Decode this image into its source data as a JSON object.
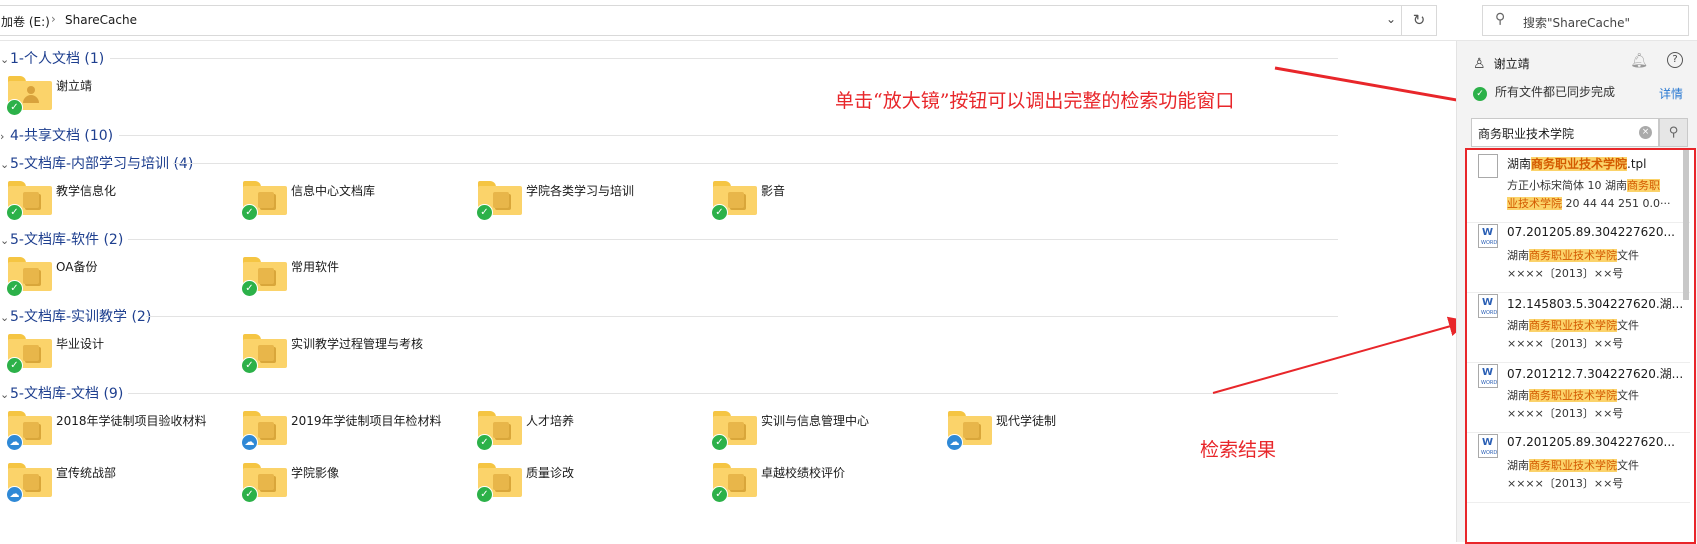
{
  "address": {
    "drive": "加卷 (E:)",
    "folder": "ShareCache",
    "search_placeholder": "搜索\"ShareCache\""
  },
  "groups": [
    {
      "title": "1-个人文档 (1)",
      "items": [
        {
          "name": "谢立靖",
          "status": "ok",
          "kind": "user"
        }
      ]
    },
    {
      "title": "4-共享文档 (10)",
      "collapsed": true,
      "items": []
    },
    {
      "title": "5-文档库-内部学习与培训 (4)",
      "items": [
        {
          "name": "教学信息化",
          "status": "ok"
        },
        {
          "name": "信息中心文档库",
          "status": "ok"
        },
        {
          "name": "学院各类学习与培训",
          "status": "ok"
        },
        {
          "name": "影音",
          "status": "ok"
        }
      ]
    },
    {
      "title": "5-文档库-软件 (2)",
      "items": [
        {
          "name": "OA备份",
          "status": "ok"
        },
        {
          "name": "常用软件",
          "status": "ok"
        }
      ]
    },
    {
      "title": "5-文档库-实训教学 (2)",
      "items": [
        {
          "name": "毕业设计",
          "status": "ok"
        },
        {
          "name": "实训教学过程管理与考核",
          "status": "ok"
        }
      ]
    },
    {
      "title": "5-文档库-文档 (9)",
      "items": [
        {
          "name": "2018年学徒制项目验收材料",
          "status": "cloud"
        },
        {
          "name": "2019年学徒制项目年检材料",
          "status": "cloud"
        },
        {
          "name": "人才培养",
          "status": "ok"
        },
        {
          "name": "实训与信息管理中心",
          "status": "ok"
        },
        {
          "name": "现代学徒制",
          "status": "cloud"
        },
        {
          "name": "宣传统战部",
          "status": "cloud"
        },
        {
          "name": "学院影像",
          "status": "ok"
        },
        {
          "name": "质量诊改",
          "status": "ok"
        },
        {
          "name": "卓越校绩校评价",
          "status": "ok"
        }
      ]
    }
  ],
  "annotations": {
    "top": "单击“放大镜”按钮可以调出完整的检索功能窗口",
    "bottom": "检索结果"
  },
  "panel": {
    "user": "谢立靖",
    "sync_status": "所有文件都已同步完成",
    "detail_link": "详情",
    "query": "商务职业技术学院"
  },
  "results": [
    {
      "type": "tpl",
      "title_pre": "湖南",
      "title_hl": "商务职业技术学院",
      "title_post": ".tpl",
      "line2_pre": "方正小标宋简体 10 湖南",
      "line2_hl": "商务职",
      "line3_hl": "业技术学院",
      "line3_post": " 20 44 44 251 0.0···"
    },
    {
      "type": "word",
      "title": "07.201205.89.304227620...",
      "line2_pre": "湖南",
      "line2_hl": "商务职业技术学院",
      "line2_post": "文件",
      "line3": "××××〔2013〕××号"
    },
    {
      "type": "word",
      "title": "12.145803.5.304227620.湖...",
      "line2_pre": "湖南",
      "line2_hl": "商务职业技术学院",
      "line2_post": "文件",
      "line3": "××××〔2013〕××号"
    },
    {
      "type": "word",
      "title": "07.201212.7.304227620.湖...",
      "line2_pre": "湖南",
      "line2_hl": "商务职业技术学院",
      "line2_post": "文件",
      "line3": "××××〔2013〕××号"
    },
    {
      "type": "word",
      "title": "07.201205.89.304227620...",
      "line2_pre": "湖南",
      "line2_hl": "商务职业技术学院",
      "line2_post": "文件",
      "line3": "××××〔2013〕××号"
    }
  ],
  "colors": {
    "accent": "#1e3f8f",
    "annotation": "#e8262a",
    "highlight": "#fbd36a",
    "ok": "#2cb149",
    "cloud": "#2f89d6"
  },
  "icons": {
    "file_word": "word-file-icon",
    "file_tpl": "tpl-file-icon",
    "folder": "folder-icon"
  }
}
